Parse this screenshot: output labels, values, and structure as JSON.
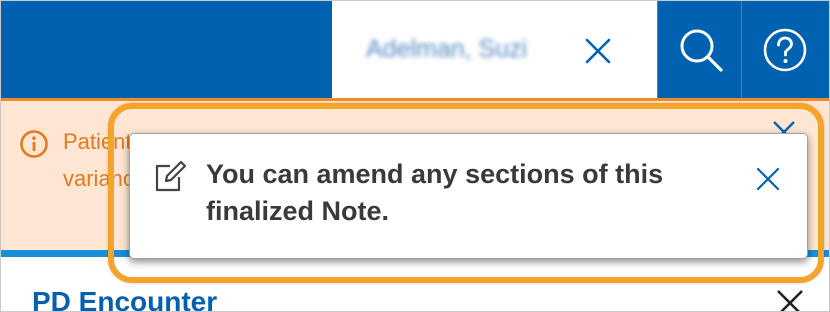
{
  "header": {
    "patient_name": "Adelman, Suzi",
    "close_patient_icon": "close-icon",
    "search_icon": "search-icon",
    "help_icon": "help-icon"
  },
  "alert": {
    "icon": "info-icon",
    "text": "Patient's schedules update and the complete time zone variance",
    "close_icon": "close-icon"
  },
  "toast": {
    "icon": "edit-note-icon",
    "message": "You can amend any sections of this finalized Note.",
    "close_icon": "close-icon"
  },
  "encounter": {
    "title": "PD Encounter",
    "close_icon": "close-icon"
  },
  "colors": {
    "brand_blue": "#0061b0",
    "alert_orange": "#e8781e",
    "alert_bg": "#fde7d2",
    "highlight": "#f4a42a"
  }
}
